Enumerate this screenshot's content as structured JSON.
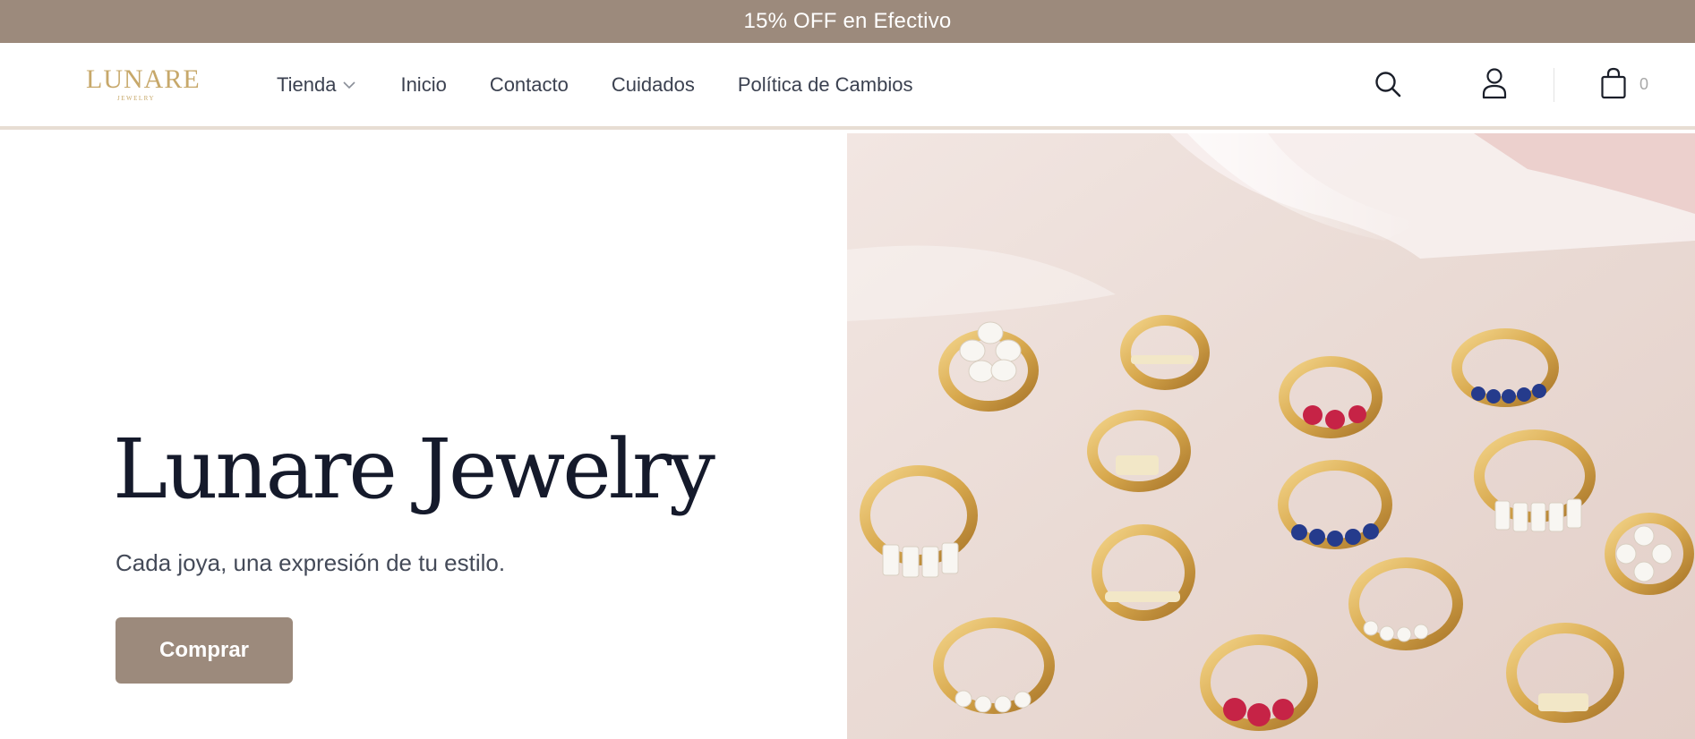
{
  "promo": {
    "text": "15% OFF en Efectivo"
  },
  "header": {
    "logo": {
      "main": "LUNARE",
      "sub": "JEWELRY"
    },
    "nav": [
      "Tienda",
      "Inicio",
      "Contacto",
      "Cuidados",
      "Política de Cambios"
    ],
    "icons": {
      "search": "search-icon",
      "account": "user-icon",
      "cart": "shopping-bag-icon",
      "dropdown": "chevron-down-icon"
    },
    "cart_count": "0"
  },
  "hero": {
    "title": "Lunare Jewelry",
    "subtitle": "Cada joya, una expresión de tu estilo.",
    "cta": "Comprar"
  },
  "colors": {
    "accent": "#9c8a7c",
    "logo_gold": "#c7a86a",
    "title": "#151a2b",
    "text": "#3b4150",
    "header_border": "#e7ddd3"
  }
}
